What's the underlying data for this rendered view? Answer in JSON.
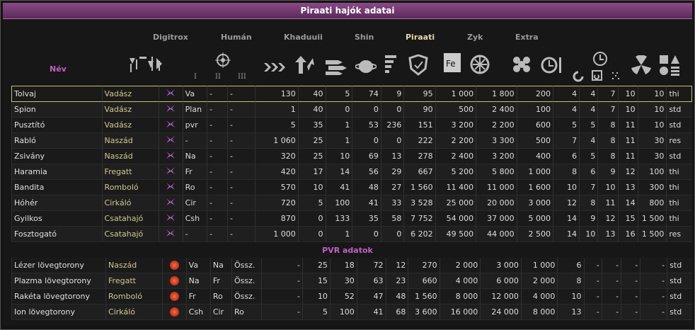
{
  "title": "Piraati hajók adatai",
  "tabs": [
    "Digitrox",
    "Humán",
    "Khaduuii",
    "Shin",
    "Piraati",
    "Zyk",
    "Extra"
  ],
  "active_tab": "Piraati",
  "header": {
    "name_label": "Név",
    "roman": [
      "I",
      "II",
      "III"
    ]
  },
  "ships": [
    {
      "name": "Tolvaj",
      "cls": "Vadász",
      "t1": "Va",
      "t2": "-",
      "t3": "-",
      "v": [
        "130",
        "40",
        "5",
        "74",
        "9",
        "95",
        "1 000",
        "1 800",
        "200",
        "4",
        "4",
        "7",
        "10",
        "10",
        "thi"
      ]
    },
    {
      "name": "Spion",
      "cls": "Vadász",
      "t1": "Plan",
      "t2": "-",
      "t3": "-",
      "v": [
        "1",
        "40",
        "0",
        "0",
        "0",
        "90",
        "500",
        "2 400",
        "100",
        "4",
        "4",
        "7",
        "10",
        "10",
        "std"
      ]
    },
    {
      "name": "Pusztító",
      "cls": "Vadász",
      "t1": "pvr",
      "t2": "-",
      "t3": "-",
      "v": [
        "5",
        "35",
        "1",
        "53",
        "236",
        "151",
        "3 200",
        "2 200",
        "600",
        "5",
        "5",
        "8",
        "11",
        "10",
        "std"
      ]
    },
    {
      "name": "Rabló",
      "cls": "Naszád",
      "t1": "-",
      "t2": "-",
      "t3": "-",
      "v": [
        "1 060",
        "25",
        "1",
        "0",
        "0",
        "222",
        "2 200",
        "3 300",
        "500",
        "7",
        "4",
        "8",
        "11",
        "30",
        "res"
      ]
    },
    {
      "name": "Zsivány",
      "cls": "Naszád",
      "t1": "Na",
      "t2": "-",
      "t3": "-",
      "v": [
        "320",
        "25",
        "10",
        "69",
        "13",
        "278",
        "2 400",
        "3 200",
        "400",
        "6",
        "5",
        "8",
        "11",
        "30",
        "std"
      ]
    },
    {
      "name": "Haramia",
      "cls": "Fregatt",
      "t1": "Fr",
      "t2": "-",
      "t3": "-",
      "v": [
        "420",
        "17",
        "14",
        "56",
        "29",
        "667",
        "5 200",
        "5 800",
        "1 000",
        "8",
        "6",
        "9",
        "12",
        "100",
        "thi"
      ]
    },
    {
      "name": "Bandita",
      "cls": "Romboló",
      "t1": "Ro",
      "t2": "-",
      "t3": "-",
      "v": [
        "570",
        "10",
        "41",
        "48",
        "27",
        "1 560",
        "11 400",
        "11 000",
        "1 600",
        "10",
        "7",
        "10",
        "13",
        "300",
        "thi"
      ]
    },
    {
      "name": "Hóhér",
      "cls": "Cirkáló",
      "t1": "Cir",
      "t2": "-",
      "t3": "-",
      "v": [
        "720",
        "5",
        "100",
        "41",
        "33",
        "3 528",
        "25 000",
        "20 000",
        "3 000",
        "12",
        "8",
        "11",
        "14",
        "800",
        "thi"
      ]
    },
    {
      "name": "Gyilkos",
      "cls": "Csatahajó",
      "t1": "Csh",
      "t2": "-",
      "t3": "-",
      "v": [
        "870",
        "0",
        "133",
        "35",
        "58",
        "7 752",
        "54 000",
        "37 000",
        "5 000",
        "14",
        "9",
        "12",
        "15",
        "1 500",
        "thi"
      ]
    },
    {
      "name": "Fosztogató",
      "cls": "Csatahajó",
      "t1": "-",
      "t2": "-",
      "t3": "-",
      "v": [
        "1 000",
        "0",
        "1",
        "0",
        "0",
        "6 202",
        "49 500",
        "44 000",
        "2 500",
        "14",
        "10",
        "13",
        "16",
        "1 500",
        "res"
      ]
    }
  ],
  "pvr_title": "PVR adatok",
  "towers": [
    {
      "name": "Lézer lövegtorony",
      "cls": "Naszád",
      "t1": "Va",
      "t2": "Na",
      "t3": "Össz.",
      "v": [
        "-",
        "25",
        "18",
        "72",
        "12",
        "270",
        "2 000",
        "3 000",
        "1 000",
        "6",
        "-",
        "-",
        "-",
        "-",
        "std"
      ]
    },
    {
      "name": "Plazma lövegtorony",
      "cls": "Fregatt",
      "t1": "Na",
      "t2": "Fr",
      "t3": "Össz.",
      "v": [
        "-",
        "15",
        "30",
        "63",
        "23",
        "660",
        "4 000",
        "6 000",
        "2 000",
        "8",
        "-",
        "-",
        "-",
        "-",
        "std"
      ]
    },
    {
      "name": "Rakéta lövegtorony",
      "cls": "Romboló",
      "t1": "Fr",
      "t2": "Ro",
      "t3": "Össz.",
      "v": [
        "-",
        "10",
        "52",
        "47",
        "48",
        "1 560",
        "8 000",
        "12 000",
        "4 000",
        "10",
        "-",
        "-",
        "-",
        "-",
        "std"
      ]
    },
    {
      "name": "Ion lövegtorony",
      "cls": "Cirkáló",
      "t1": "Csh",
      "t2": "Cir",
      "t3": "Ro",
      "v": [
        "-",
        "5",
        "100",
        "41",
        "68",
        "3 600",
        "16 000",
        "24 000",
        "8 000",
        "13",
        "-",
        "-",
        "-",
        "-",
        "std"
      ]
    }
  ],
  "colors": {
    "accent": "#c060c0",
    "title_bar": "#7a3a78",
    "class_text": "#d0c890",
    "selection": "#c8c070"
  }
}
